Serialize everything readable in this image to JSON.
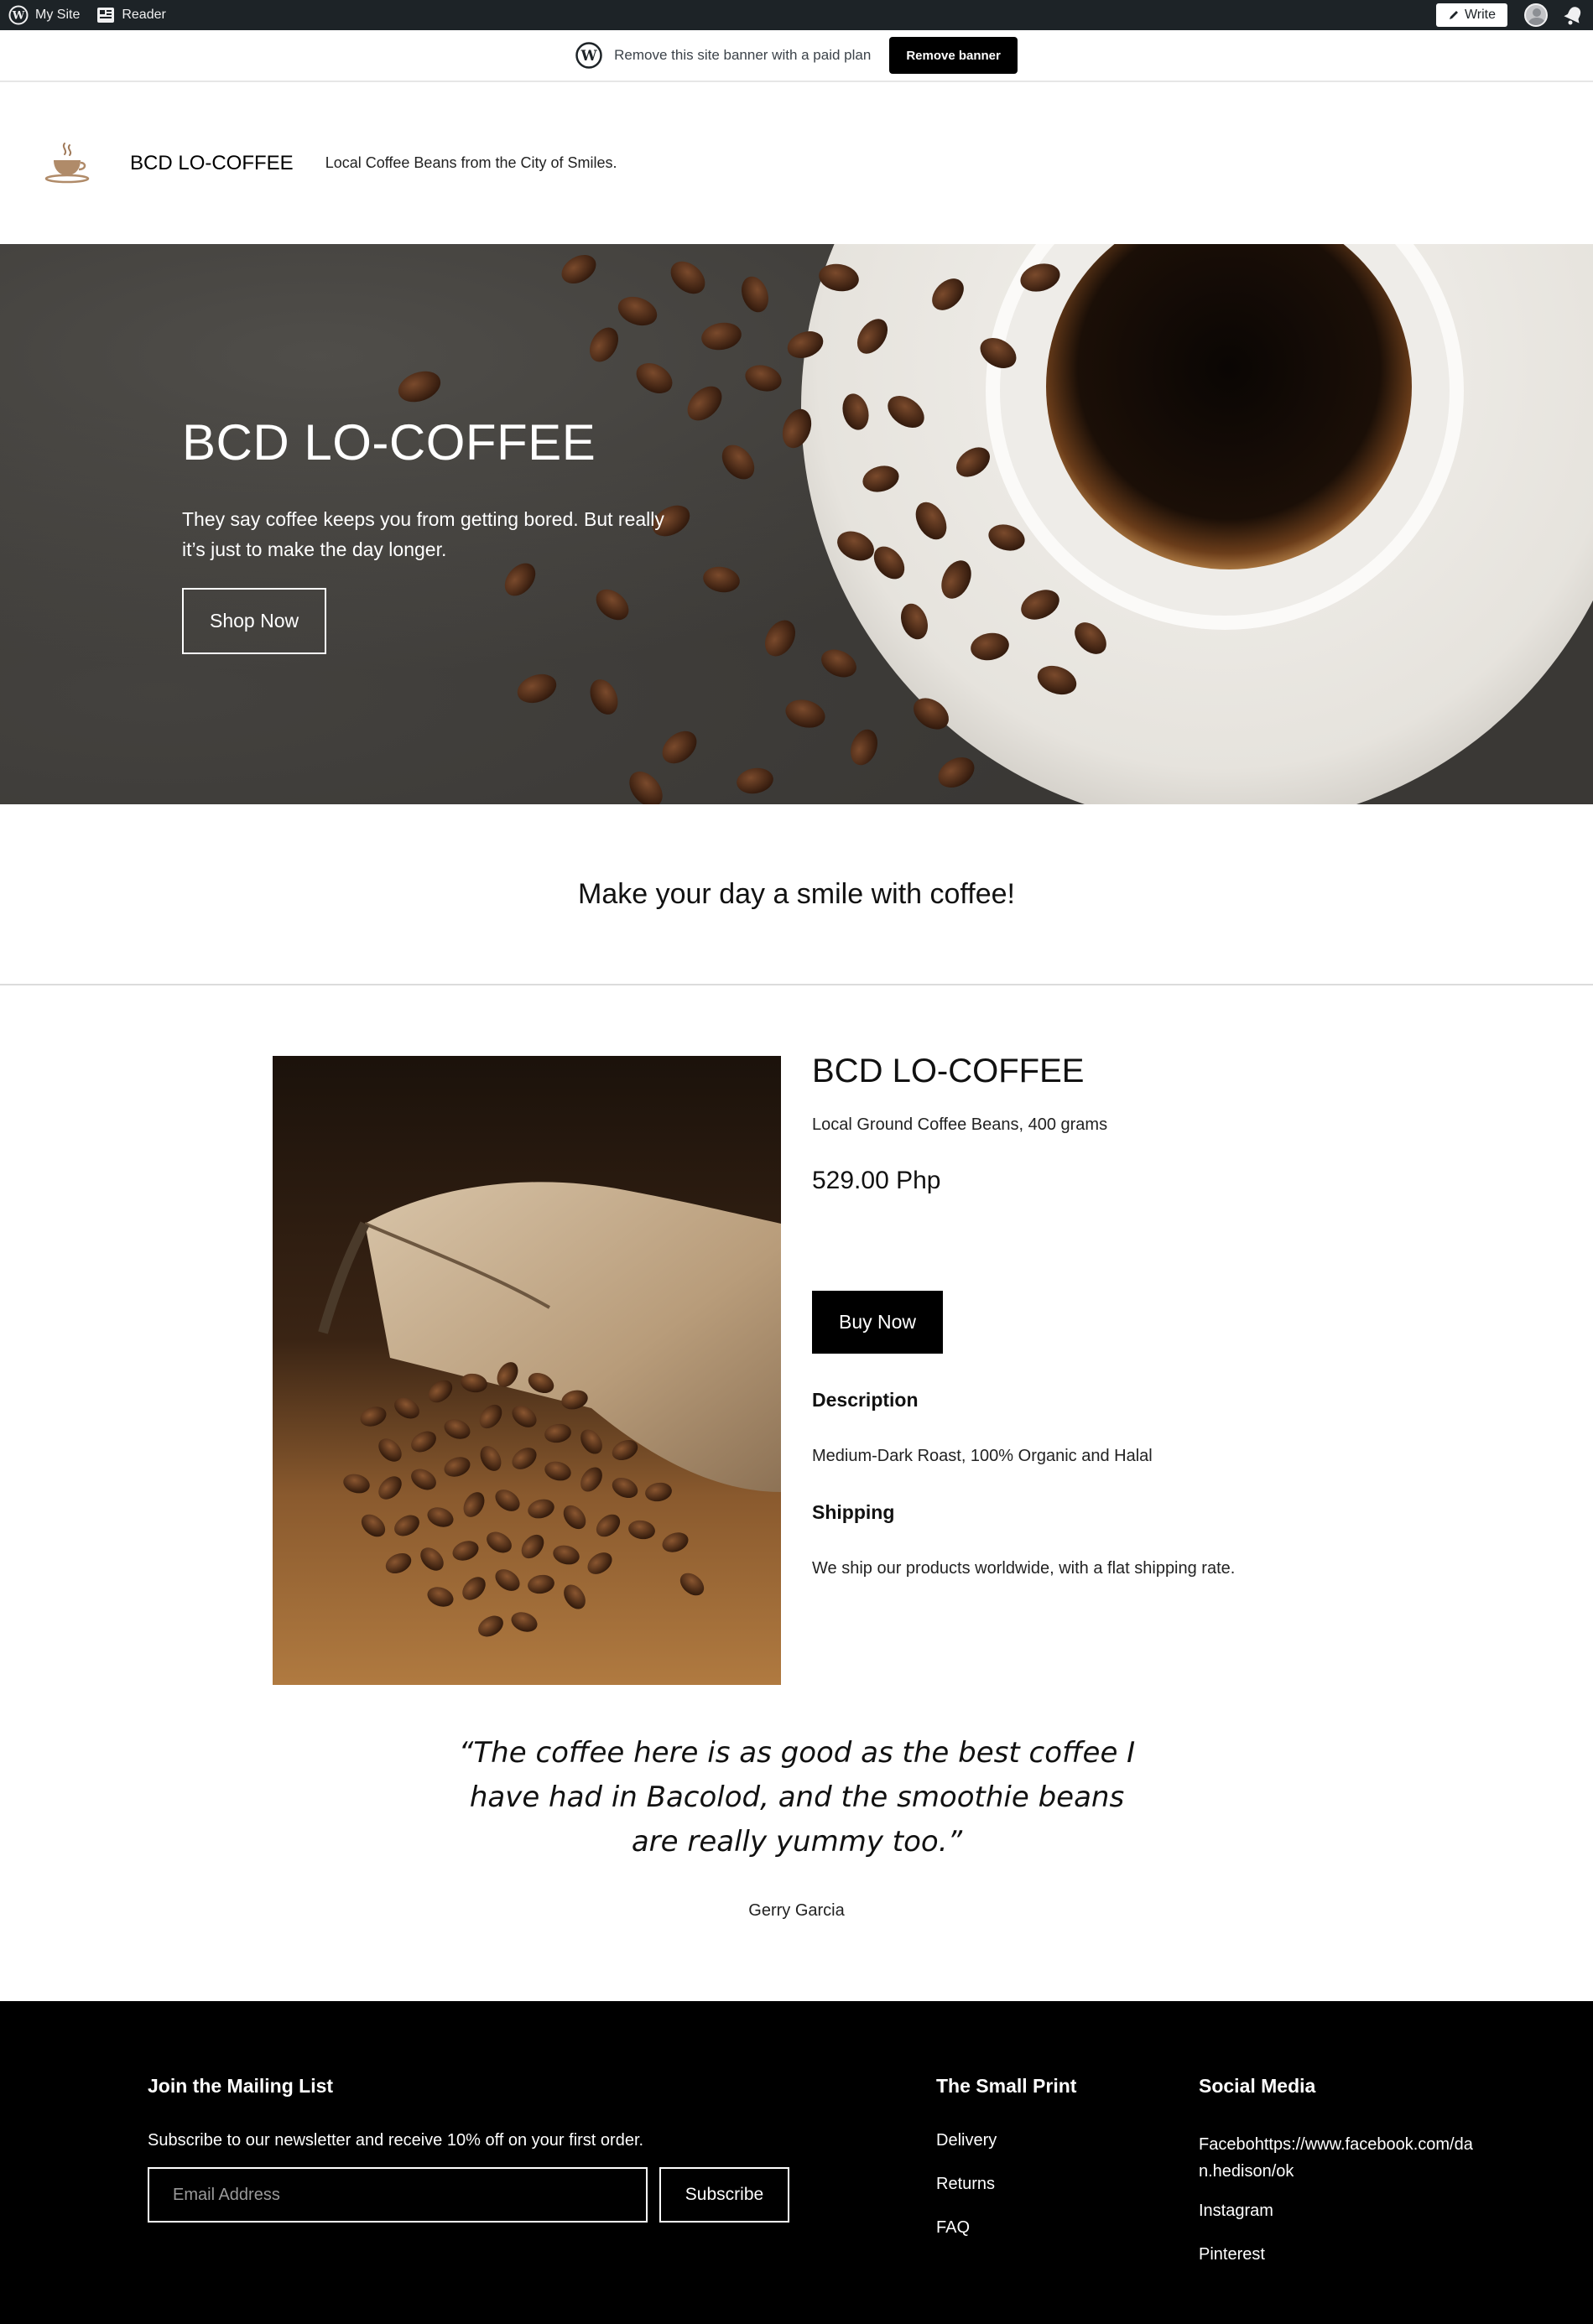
{
  "adminbar": {
    "my_site": "My Site",
    "reader": "Reader",
    "write": "Write"
  },
  "banner": {
    "text": "Remove this site banner with a paid plan",
    "button": "Remove banner"
  },
  "site": {
    "title": "BCD LO-COFFEE",
    "tagline": "Local Coffee Beans from the City of Smiles."
  },
  "hero": {
    "title": "BCD LO-COFFEE",
    "subtitle": "They say coffee keeps you from getting bored. But really it’s just to make the day longer.",
    "button": "Shop Now"
  },
  "intro": {
    "text": "Make your day a smile with coffee!"
  },
  "product": {
    "title": "BCD LO-COFFEE",
    "subtitle": "Local Ground Coffee Beans, 400 grams",
    "price": "529.00 Php",
    "buy": "Buy Now",
    "description_heading": "Description",
    "description": "Medium-Dark Roast, 100% Organic and Halal",
    "shipping_heading": "Shipping",
    "shipping": "We ship our products worldwide, with a flat shipping rate."
  },
  "testimonial": {
    "quote": "“The coffee here is as good as the best coffee I have had in Bacolod, and the smoothie beans are really yummy too.”",
    "author": "Gerry Garcia"
  },
  "footer": {
    "mailing_heading": "Join the Mailing List",
    "mailing_text": "Subscribe to our newsletter and receive 10% off on your first order.",
    "email_placeholder": "Email Address",
    "subscribe": "Subscribe",
    "small_print_heading": "The Small Print",
    "small_print_links": [
      "Delivery",
      "Returns",
      "FAQ"
    ],
    "social_heading": "Social Media",
    "social_links": [
      "Facebohttps://www.facebook.com/dan.hedison/ok",
      "Instagram",
      "Pinterest"
    ]
  },
  "colors": {
    "adminbar_bg": "#1d2327",
    "footer_bg": "#000000",
    "button_bg": "#000000"
  }
}
